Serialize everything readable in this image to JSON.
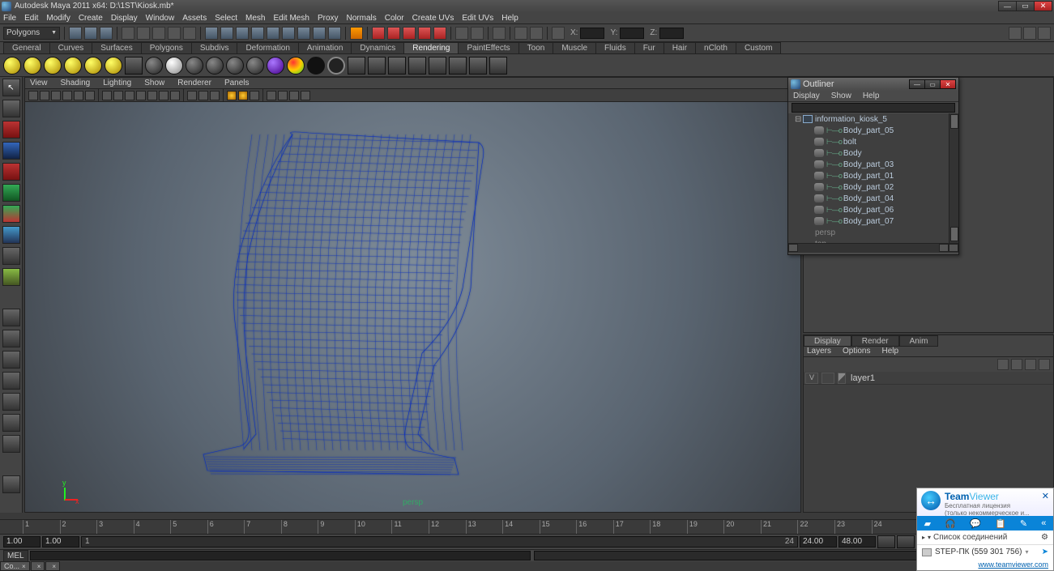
{
  "title": "Autodesk Maya 2011 x64: D:\\1ST\\Kiosk.mb*",
  "menu": [
    "File",
    "Edit",
    "Modify",
    "Create",
    "Display",
    "Window",
    "Assets",
    "Select",
    "Mesh",
    "Edit Mesh",
    "Proxy",
    "Normals",
    "Color",
    "Create UVs",
    "Edit UVs",
    "Help"
  ],
  "mode_combo": "Polygons",
  "coord_labels": {
    "x": "X:",
    "y": "Y:",
    "z": "Z:"
  },
  "shelf_tabs": [
    "General",
    "Curves",
    "Surfaces",
    "Polygons",
    "Subdivs",
    "Deformation",
    "Animation",
    "Dynamics",
    "Rendering",
    "PaintEffects",
    "Toon",
    "Muscle",
    "Fluids",
    "Fur",
    "Hair",
    "nCloth",
    "Custom"
  ],
  "shelf_active": "Rendering",
  "viewport_menu": [
    "View",
    "Shading",
    "Lighting",
    "Show",
    "Renderer",
    "Panels"
  ],
  "persp_label": "persp",
  "axis": {
    "x": "x",
    "y": "y"
  },
  "outliner": {
    "title": "Outliner",
    "menu": [
      "Display",
      "Show",
      "Help"
    ],
    "items": [
      {
        "indent": 0,
        "icon": "mesh",
        "exp": "⊟",
        "name": "information_kiosk_5"
      },
      {
        "indent": 1,
        "icon": "hidden",
        "branch": "⊢—o",
        "name": "Body_part_05"
      },
      {
        "indent": 1,
        "icon": "hidden",
        "branch": "⊢—o",
        "name": "bolt"
      },
      {
        "indent": 1,
        "icon": "hidden",
        "branch": "⊢—o",
        "name": "Body"
      },
      {
        "indent": 1,
        "icon": "hidden",
        "branch": "⊢—o",
        "name": "Body_part_03"
      },
      {
        "indent": 1,
        "icon": "hidden",
        "branch": "⊢—o",
        "name": "Body_part_01"
      },
      {
        "indent": 1,
        "icon": "hidden",
        "branch": "⊢—o",
        "name": "Body_part_02"
      },
      {
        "indent": 1,
        "icon": "hidden",
        "branch": "⊢—o",
        "name": "Body_part_04"
      },
      {
        "indent": 1,
        "icon": "hidden",
        "branch": "⊢—o",
        "name": "Body_part_06"
      },
      {
        "indent": 1,
        "icon": "hidden",
        "branch": "⊢—o",
        "name": "Body_part_07"
      },
      {
        "indent": 0,
        "icon": "cam",
        "name": "persp",
        "dim": true
      },
      {
        "indent": 0,
        "icon": "cam",
        "name": "top",
        "dim": true
      }
    ]
  },
  "layers": {
    "tabs": [
      "Display",
      "Render",
      "Anim"
    ],
    "active": "Display",
    "menu": [
      "Layers",
      "Options",
      "Help"
    ],
    "row": {
      "vis": "V",
      "type": "",
      "name": "layer1"
    }
  },
  "timeline": {
    "ticks": [
      "1",
      "2",
      "3",
      "4",
      "5",
      "6",
      "7",
      "8",
      "9",
      "10",
      "11",
      "12",
      "13",
      "14",
      "15",
      "16",
      "17",
      "18",
      "19",
      "20",
      "21",
      "22",
      "23",
      "24"
    ],
    "end_label": "1.00",
    "range_start": "1.00",
    "play_start": "1.00",
    "slider_start": "1",
    "slider_end": "24",
    "play_end": "24.00",
    "range_end": "48.00"
  },
  "cmd": {
    "label": "MEL"
  },
  "task_tabs": [
    "Co...",
    "",
    ""
  ],
  "teamviewer": {
    "brand1": "Team",
    "brand2": "Viewer",
    "sub1": "Бесплатная лицензия",
    "sub2": "(только некоммерческое и...",
    "section": "Список соединений",
    "conn": "STEP-ПК (559 301 756)",
    "link": "www.teamviewer.com"
  }
}
